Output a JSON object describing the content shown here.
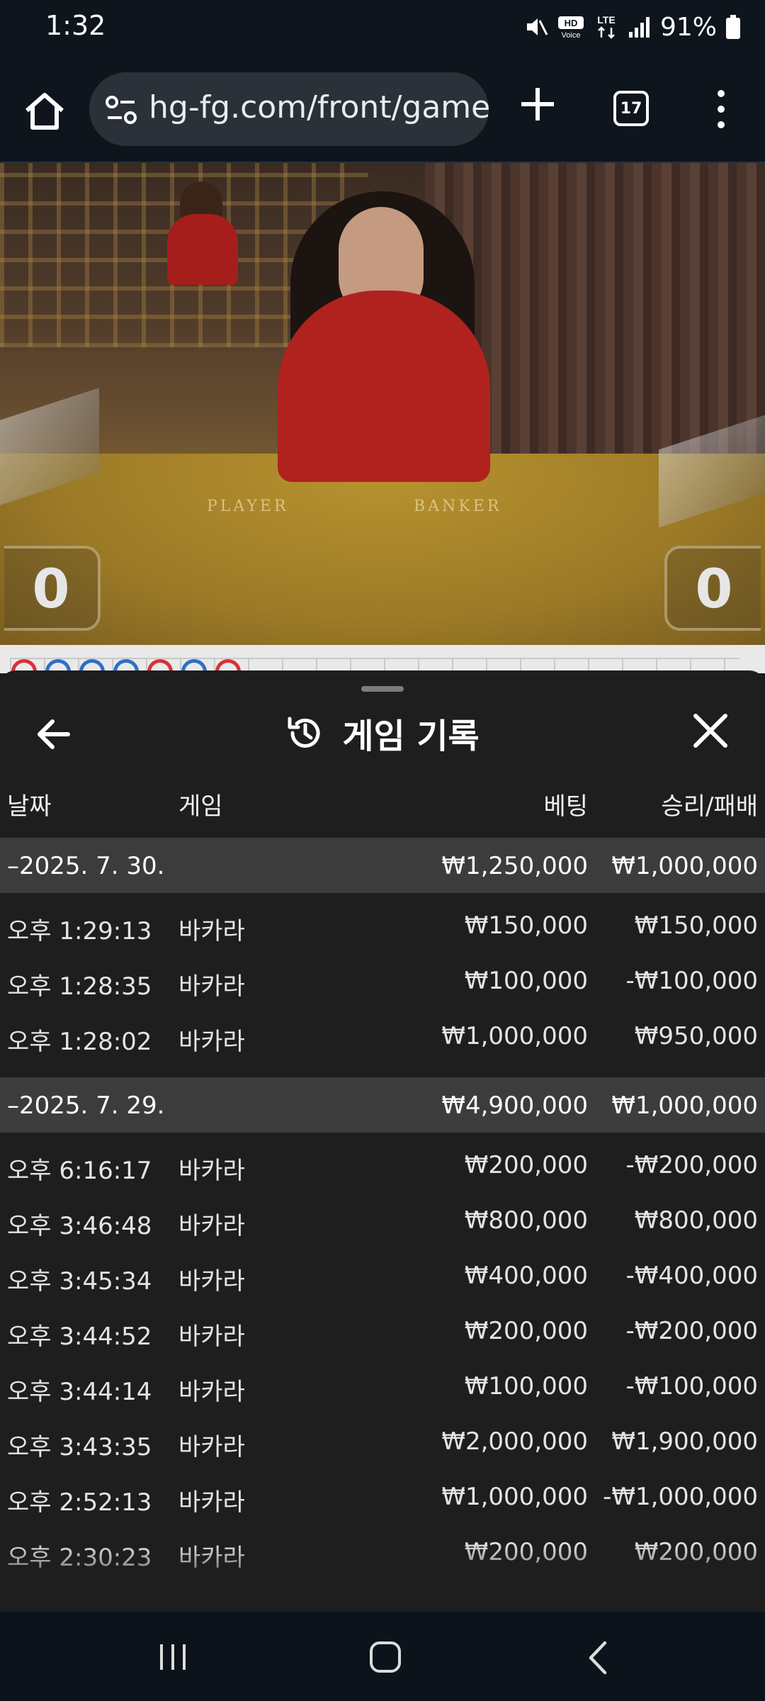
{
  "status_bar": {
    "time": "1:32",
    "network": "LTE",
    "hd_voice": "HD Voice",
    "battery": "91%"
  },
  "browser": {
    "url": "hg-fg.com/front/game/|",
    "tab_count": "17"
  },
  "video": {
    "player_label": "PLAYER",
    "banker_label": "BANKER",
    "score_left": "0",
    "score_right": "0"
  },
  "roadmap": {
    "colors": [
      "#d8303a",
      "#2d6fc8",
      "#2d6fc8",
      "#2d6fc8",
      "#d8303a",
      "#2d6fc8",
      "#d8303a"
    ]
  },
  "sheet": {
    "title": "게임 기록",
    "columns": {
      "date": "날짜",
      "game": "게임",
      "bet": "베팅",
      "win_loss": "승리/패배"
    },
    "groups": [
      {
        "date": "–2025. 7. 30.",
        "total_bet": "₩1,250,000",
        "total_win_loss": "₩1,000,000",
        "rows": [
          {
            "time": "오후 1:29:13",
            "game": "바카라",
            "bet": "₩150,000",
            "win_loss": "₩150,000"
          },
          {
            "time": "오후 1:28:35",
            "game": "바카라",
            "bet": "₩100,000",
            "win_loss": "-₩100,000"
          },
          {
            "time": "오후 1:28:02",
            "game": "바카라",
            "bet": "₩1,000,000",
            "win_loss": "₩950,000"
          }
        ]
      },
      {
        "date": "–2025. 7. 29.",
        "total_bet": "₩4,900,000",
        "total_win_loss": "₩1,000,000",
        "rows": [
          {
            "time": "오후 6:16:17",
            "game": "바카라",
            "bet": "₩200,000",
            "win_loss": "-₩200,000"
          },
          {
            "time": "오후 3:46:48",
            "game": "바카라",
            "bet": "₩800,000",
            "win_loss": "₩800,000"
          },
          {
            "time": "오후 3:45:34",
            "game": "바카라",
            "bet": "₩400,000",
            "win_loss": "-₩400,000"
          },
          {
            "time": "오후 3:44:52",
            "game": "바카라",
            "bet": "₩200,000",
            "win_loss": "-₩200,000"
          },
          {
            "time": "오후 3:44:14",
            "game": "바카라",
            "bet": "₩100,000",
            "win_loss": "-₩100,000"
          },
          {
            "time": "오후 3:43:35",
            "game": "바카라",
            "bet": "₩2,000,000",
            "win_loss": "₩1,900,000"
          },
          {
            "time": "오후 2:52:13",
            "game": "바카라",
            "bet": "₩1,000,000",
            "win_loss": "-₩1,000,000"
          },
          {
            "time": "오후 2:30:23",
            "game": "바카라",
            "bet": "₩200,000",
            "win_loss": "₩200,000"
          }
        ]
      }
    ]
  }
}
